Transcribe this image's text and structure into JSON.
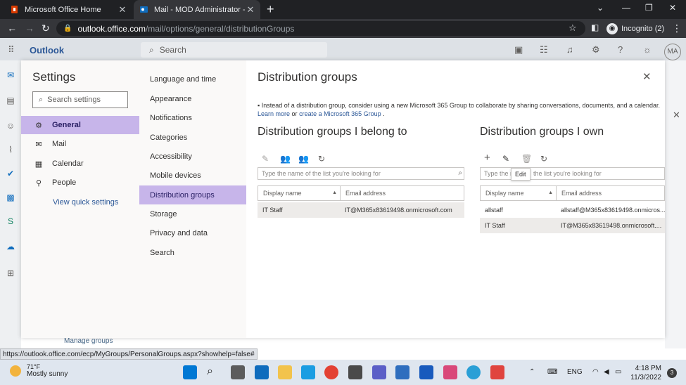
{
  "browser": {
    "tabs": [
      {
        "title": "Microsoft Office Home",
        "close": "✕"
      },
      {
        "title": "Mail - MOD Administrator - Outl",
        "close": "✕"
      }
    ],
    "new_tab": "+",
    "url_host": "outlook.office.com",
    "url_path": "/mail/options/general/distributionGroups",
    "profile_label": "Incognito (2)",
    "status_url": "https://outlook.office.com/ecp/MyGroups/PersonalGroups.aspx?showhelp=false#"
  },
  "owa": {
    "brand": "Outlook",
    "search_placeholder": "Search",
    "avatar_initials": "MA",
    "behind_link": "Manage groups"
  },
  "settings": {
    "title": "Settings",
    "search_placeholder": "Search settings",
    "categories": [
      {
        "label": "General",
        "icon": "gear-icon"
      },
      {
        "label": "Mail",
        "icon": "mail-icon"
      },
      {
        "label": "Calendar",
        "icon": "calendar-icon"
      },
      {
        "label": "People",
        "icon": "people-icon"
      }
    ],
    "quick_settings_link": "View quick settings",
    "subcategories": [
      "Language and time",
      "Appearance",
      "Notifications",
      "Categories",
      "Accessibility",
      "Mobile devices",
      "Distribution groups",
      "Storage",
      "Privacy and data",
      "Search"
    ]
  },
  "pane": {
    "title": "Distribution groups",
    "notice_text": "Instead of a distribution group, consider using a new Microsoft 365 Group to collaborate by sharing conversations, documents, and a calendar.",
    "learn_more": "Learn more",
    "or": "or",
    "create_link": "create a Microsoft 365 Group",
    "notice_end": ".",
    "member_of": {
      "title": "Distribution groups I belong to",
      "search_placeholder": "Type the name of the list you're looking for",
      "columns": [
        "Display name",
        "Email address"
      ],
      "rows": [
        {
          "name": "IT Staff",
          "email": "IT@M365x83619498.onmicrosoft.com"
        }
      ]
    },
    "owner_of": {
      "title": "Distribution groups I own",
      "search_placeholder": "Type the n",
      "search_placeholder_rest": "the list you're looking for",
      "columns": [
        "Display name",
        "Email address"
      ],
      "rows": [
        {
          "name": "allstaff",
          "email": "allstaff@M365x83619498.onmicros..."
        },
        {
          "name": "IT Staff",
          "email": "IT@M365x83619498.onmicrosoft...."
        }
      ]
    },
    "tooltip": "Edit"
  },
  "taskbar": {
    "temperature": "71°F",
    "weather": "Mostly sunny",
    "language": "ENG",
    "time": "4:18 PM",
    "date": "11/3/2022",
    "notification_count": "3"
  }
}
